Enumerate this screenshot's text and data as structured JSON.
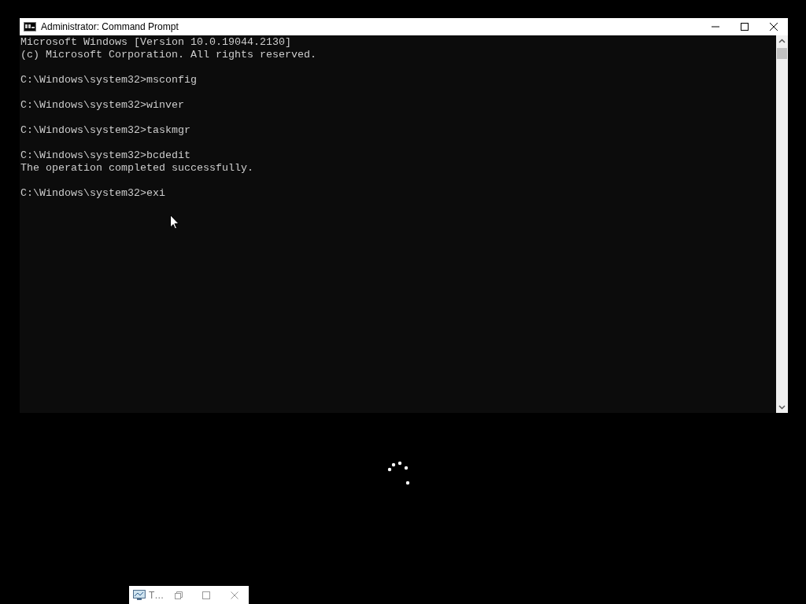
{
  "window": {
    "title": "Administrator:  Command Prompt"
  },
  "console": {
    "blocks": [
      [
        "Microsoft Windows [Version 10.0.19044.2130]",
        "(c) Microsoft Corporation. All rights reserved."
      ],
      [
        "C:\\Windows\\system32>msconfig"
      ],
      [
        "C:\\Windows\\system32>winver"
      ],
      [
        "C:\\Windows\\system32>taskmgr"
      ],
      [
        "C:\\Windows\\system32>bcdedit",
        "The operation completed successfully."
      ],
      [
        "C:\\Windows\\system32>exi"
      ]
    ]
  },
  "minimized_window": {
    "title": "T…"
  }
}
